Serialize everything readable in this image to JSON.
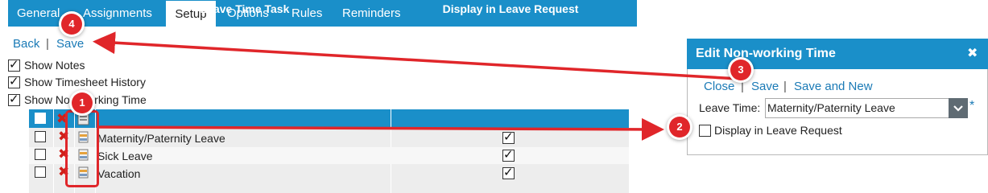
{
  "tabs": [
    {
      "label": "General",
      "active": false
    },
    {
      "label": "Assignments",
      "active": false
    },
    {
      "label": "Setup",
      "active": true
    },
    {
      "label": "Options",
      "active": false
    },
    {
      "label": "Rules",
      "active": false
    },
    {
      "label": "Reminders",
      "active": false
    }
  ],
  "actions": {
    "back": "Back",
    "separator": "|",
    "save": "Save"
  },
  "options": [
    {
      "label": "Show Notes",
      "checked": true
    },
    {
      "label": "Show Timesheet History",
      "checked": true
    },
    {
      "label": "Show Non-working Time",
      "checked": true
    }
  ],
  "table": {
    "headers": {
      "task": "Leave Time Task",
      "display": "Display in Leave Request"
    },
    "rows": [
      {
        "task": "Maternity/Paternity Leave",
        "display": true
      },
      {
        "task": "Sick Leave",
        "display": true
      },
      {
        "task": "Vacation",
        "display": true
      }
    ]
  },
  "dialog": {
    "title": "Edit Non-working Time",
    "close_icon": "close-icon",
    "actions": {
      "close": "Close",
      "save": "Save",
      "save_and_new": "Save and New",
      "separator": "|"
    },
    "leave_time_label": "Leave Time:",
    "leave_time_value": "Maternity/Paternity Leave",
    "required_mark": "*",
    "display_label": "Display in Leave Request",
    "display_checked": false
  },
  "annotations": [
    {
      "number": "1"
    },
    {
      "number": "2"
    },
    {
      "number": "3"
    },
    {
      "number": "4"
    }
  ],
  "colors": {
    "accent": "#1a8fc9",
    "link": "#1a7ab6",
    "annotation": "#e0262a",
    "delete": "#d0201a"
  }
}
